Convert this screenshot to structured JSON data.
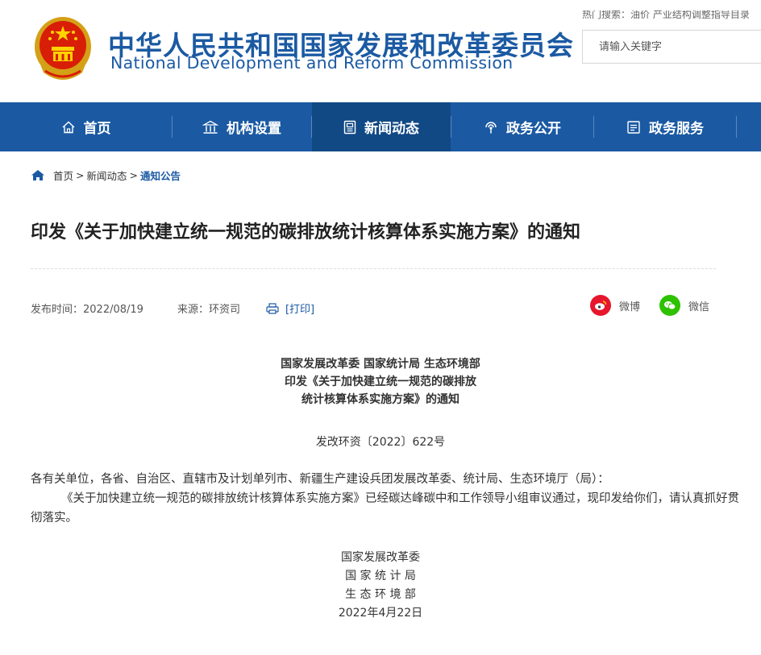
{
  "header": {
    "title_cn": "中华人民共和国国家发展和改革委员会",
    "title_en": "National Development and Reform Commission",
    "hot_search": "热门搜索：油价 产业结构调整指导目录",
    "search_placeholder": "请输入关键字"
  },
  "nav": {
    "items": [
      {
        "label": "首页",
        "icon": "home-icon"
      },
      {
        "label": "机构设置",
        "icon": "building-icon"
      },
      {
        "label": "新闻动态",
        "icon": "news-icon"
      },
      {
        "label": "政务公开",
        "icon": "broadcast-icon"
      },
      {
        "label": "政务服务",
        "icon": "service-icon"
      }
    ],
    "active": "新闻动态"
  },
  "breadcrumb": {
    "home": "首页",
    "section": "新闻动态",
    "current": "通知公告",
    "separator": ">"
  },
  "article": {
    "title": "印发《关于加快建立统一规范的碳排放统计核算体系实施方案》的通知",
    "publish_time": "发布时间：2022/08/19",
    "source": "来源：环资司",
    "print_label": "[打印]",
    "share_weibo": "微博",
    "share_wechat": "微信",
    "issuers_line1": "国家发展改革委 国家统计局 生态环境部",
    "issuers_line2": "印发《关于加快建立统一规范的碳排放",
    "issuers_line3": "统计核算体系实施方案》的通知",
    "doc_number": "发改环资〔2022〕622号",
    "para1": "各有关单位，各省、自治区、直辖市及计划单列市、新疆生产建设兵团发展改革委、统计局、生态环境厅（局）：",
    "para2": "《关于加快建立统一规范的碳排放统计核算体系实施方案》已经碳达峰碳中和工作领导小组审议通过，现印发给你们，请认真抓好贯彻落实。",
    "sign1": "国家发展改革委",
    "sign2": "国 家 统 计 局",
    "sign3": "生 态 环 境 部",
    "sign_date": "2022年4月22日"
  },
  "colors": {
    "brand_blue": "#1b5aa3",
    "nav_active": "#114985",
    "weibo_red": "#e6162d",
    "wechat_green": "#2dc100"
  }
}
